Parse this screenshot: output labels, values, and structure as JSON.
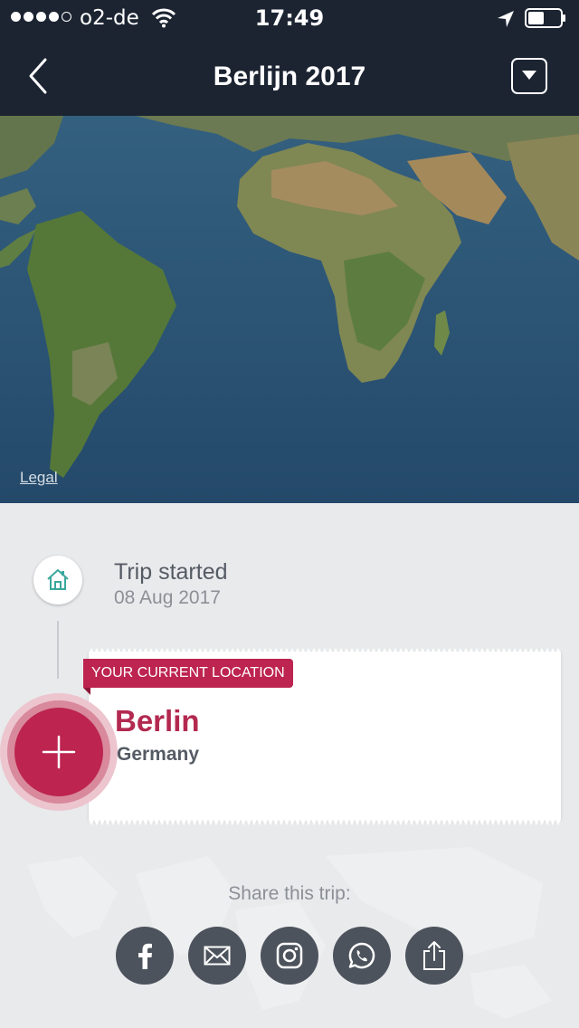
{
  "status_bar": {
    "carrier": "o2-de",
    "time": "17:49",
    "signal_bars_filled": 4,
    "signal_bars_total": 5
  },
  "nav": {
    "title": "Berlijn 2017",
    "back_icon": "chevron-left-icon",
    "menu_icon": "dropdown-menu-icon"
  },
  "map": {
    "legal_label": "Legal"
  },
  "timeline": {
    "start": {
      "label": "Trip started",
      "date": "08 Aug 2017",
      "icon": "home-icon"
    },
    "current": {
      "badge": "YOUR CURRENT LOCATION",
      "city": "Berlin",
      "country": "Germany"
    },
    "add_icon": "plus-icon"
  },
  "share": {
    "label": "Share this trip:",
    "buttons": [
      {
        "icon": "facebook-icon"
      },
      {
        "icon": "mail-icon"
      },
      {
        "icon": "instagram-icon"
      },
      {
        "icon": "whatsapp-icon"
      },
      {
        "icon": "share-icon"
      }
    ]
  },
  "colors": {
    "header_bg": "#1c2432",
    "accent": "#bd2450",
    "share_button_bg": "#4d535c",
    "background": "#e9eaec"
  }
}
